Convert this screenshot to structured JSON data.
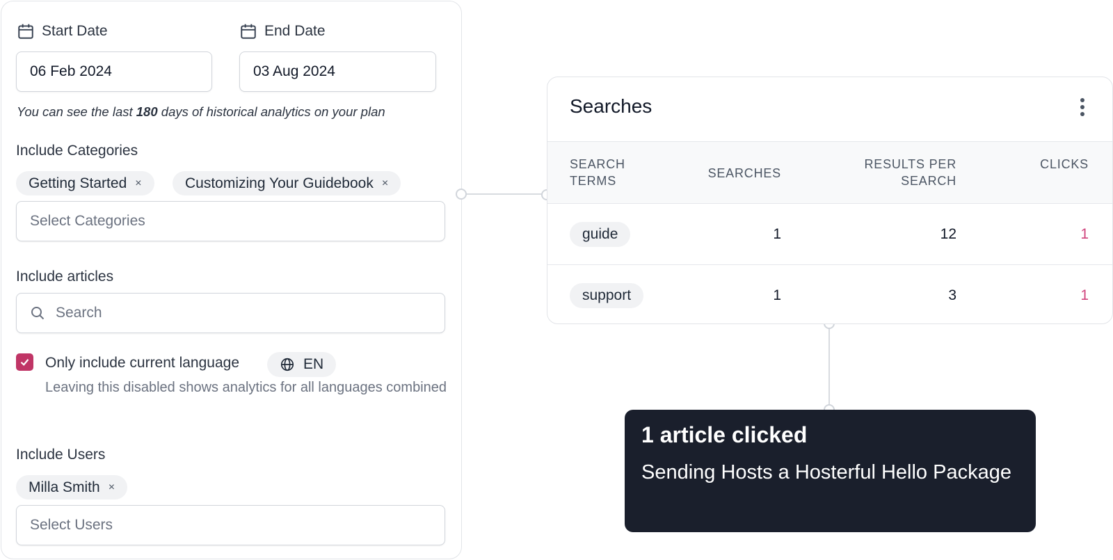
{
  "filters": {
    "start_date": {
      "label": "Start Date",
      "value": "06 Feb 2024"
    },
    "end_date": {
      "label": "End Date",
      "value": "03 Aug 2024"
    },
    "history_hint": {
      "before": "You can see the last ",
      "days": "180",
      "after": " days of historical analytics on your plan"
    },
    "categories": {
      "label": "Include Categories",
      "chips": [
        "Getting Started",
        "Customizing Your Guidebook"
      ],
      "placeholder": "Select Categories"
    },
    "articles": {
      "label": "Include articles",
      "placeholder": "Search"
    },
    "language": {
      "checked": true,
      "label": "Only include current language",
      "code": "EN",
      "helper": "Leaving this disabled shows analytics for all languages combined"
    },
    "users": {
      "label": "Include Users",
      "chips": [
        "Milla Smith"
      ],
      "placeholder": "Select Users"
    },
    "chip_remove_glyph": "×"
  },
  "searches_card": {
    "title": "Searches",
    "columns": [
      "SEARCH TERMS",
      "SEARCHES",
      "RESULTS PER SEARCH",
      "CLICKS"
    ],
    "rows": [
      {
        "term": "guide",
        "searches": "1",
        "results_per_search": "12",
        "clicks": "1"
      },
      {
        "term": "support",
        "searches": "1",
        "results_per_search": "3",
        "clicks": "1"
      }
    ]
  },
  "tooltip": {
    "title": "1 article clicked",
    "body": "Sending Hosts a Hosterful Hello Package"
  },
  "colors": {
    "accent": "#c03566",
    "click_value": "#d0447d",
    "tooltip_bg": "#1a1f2c"
  },
  "icons": [
    "calendar-icon",
    "search-icon",
    "globe-icon",
    "check-icon",
    "close-icon",
    "more-vertical-icon"
  ]
}
